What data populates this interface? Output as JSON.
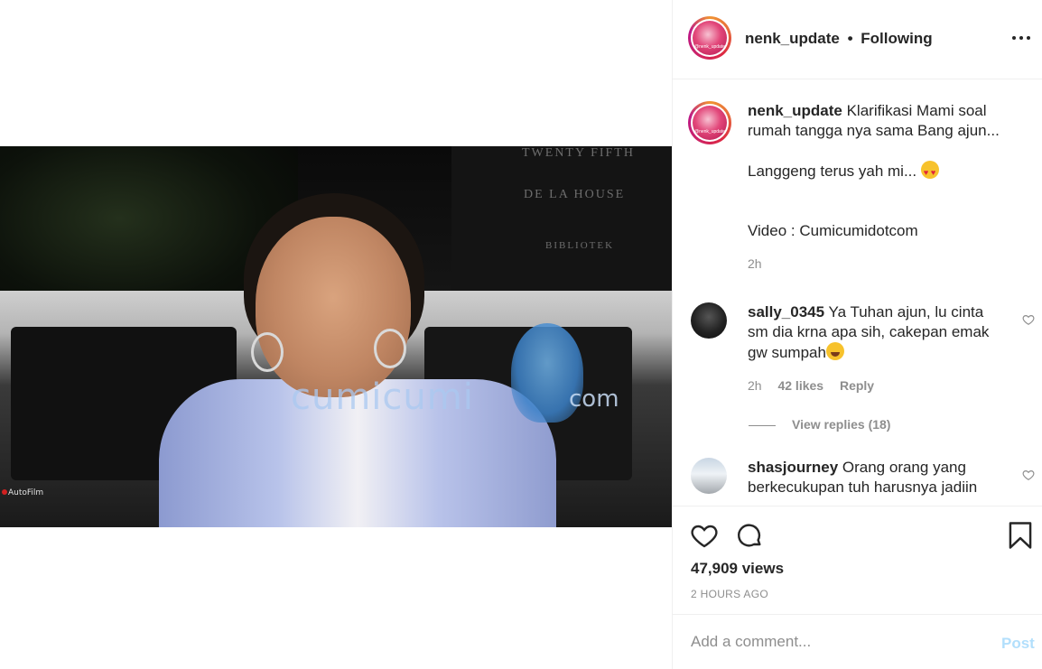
{
  "media": {
    "watermark_main": "cumicumi",
    "watermark_suffix": "com",
    "sign_lines": [
      "TWENTY FIFTH",
      "DE LA HOUSE",
      "BIBLIOTEK"
    ],
    "brand": "AutoFilm"
  },
  "header": {
    "username": "nenk_update",
    "separator": "•",
    "follow_status": "Following",
    "avatar_text": "@nenk_update",
    "more_icon": "more-horizontal-icon"
  },
  "caption": {
    "username": "nenk_update",
    "text": "Klarifikasi Mami soal rumah tangga nya sama Bang ajun...",
    "line2": "Langgeng terus yah mi... ",
    "emoji": "heart-eyes",
    "line3": "Video : Cumicumidotcom",
    "time": "2h"
  },
  "comments": [
    {
      "username": "sally_0345",
      "text": "Ya Tuhan ajun, lu cinta sm dia krna apa sih, cakepan emak gw sumpah",
      "emoji": "laughing-tears",
      "time": "2h",
      "likes": "42 likes",
      "reply": "Reply",
      "view_replies": "View replies (18)"
    },
    {
      "username": "shasjourney",
      "text": "Orang orang yang berkecukupan tuh harusnya jadiin"
    }
  ],
  "actions": {
    "like_icon": "heart-icon",
    "comment_icon": "comment-bubble-icon",
    "save_icon": "bookmark-icon",
    "views": "47,909 views",
    "posted": "2 HOURS AGO"
  },
  "add_comment": {
    "placeholder": "Add a comment...",
    "post_label": "Post"
  },
  "colors": {
    "text": "#262626",
    "muted": "#8e8e8e",
    "border": "#efefef",
    "post_disabled": "#b2dffc"
  }
}
